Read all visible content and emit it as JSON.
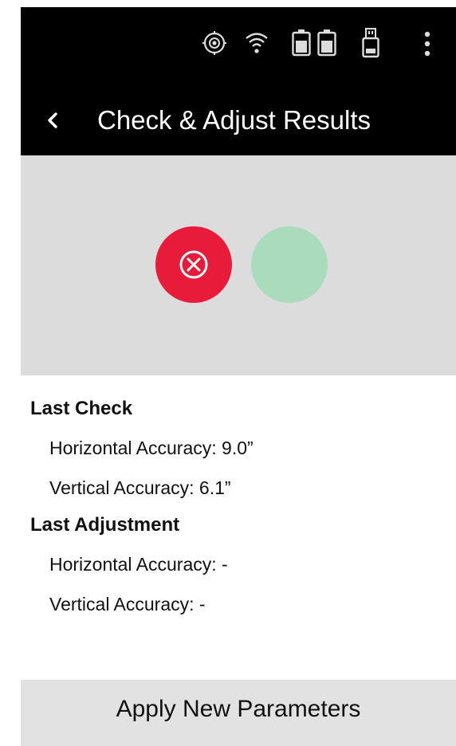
{
  "header": {
    "title": "Check & Adjust Results",
    "back_icon": "chevron-left-icon"
  },
  "status_bar": {
    "icons": [
      "target-icon",
      "wifi-icon",
      "battery-icon",
      "battery-icon",
      "usb-drive-icon",
      "more-vert-icon"
    ]
  },
  "results": {
    "status_fail_icon": "x-circle-icon",
    "fail_color": "#e81c3a",
    "ok_color": "#a9dcbd"
  },
  "last_check": {
    "heading": "Last Check",
    "horizontal": "Horizontal Accuracy: 9.0”",
    "vertical": "Vertical Accuracy: 6.1”"
  },
  "last_adjustment": {
    "heading": "Last Adjustment",
    "horizontal": "Horizontal Accuracy: -",
    "vertical": "Vertical Accuracy: -"
  },
  "footer": {
    "apply_label": "Apply New Parameters"
  }
}
